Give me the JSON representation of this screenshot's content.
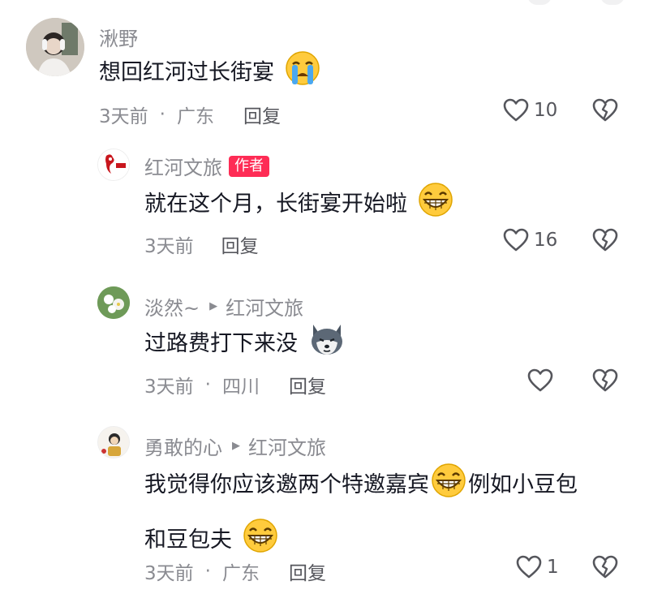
{
  "comments": [
    {
      "user": "湫野",
      "text": "想回红河过长街宴",
      "emoji": "crying-face",
      "time": "3天前",
      "location": "广东",
      "reply_label": "回复",
      "likes": "10"
    },
    {
      "user": "红河文旅",
      "author_tag": "作者",
      "text": "就在这个月，长街宴开始啦",
      "emoji": "grinning-face",
      "time": "3天前",
      "reply_label": "回复",
      "likes": "16",
      "avatar_logo_text": "红河"
    },
    {
      "user": "淡然~",
      "reply_to": "红河文旅",
      "text": "过路费打下来没",
      "emoji": "husky-dog-face",
      "time": "3天前",
      "location": "四川",
      "reply_label": "回复",
      "likes": ""
    },
    {
      "user": "勇敢的心",
      "reply_to": "红河文旅",
      "text_line1": "我觉得你应该邀两个特邀嘉宾",
      "text_line1_tail": "例如小豆包",
      "text_line2": "和豆包夫",
      "emoji": "grinning-face",
      "time": "3天前",
      "location": "广东",
      "reply_label": "回复",
      "likes": "1"
    }
  ],
  "colors": {
    "muted": "#8a8b91",
    "text": "#161823",
    "author_tag": "#fe2c55"
  }
}
